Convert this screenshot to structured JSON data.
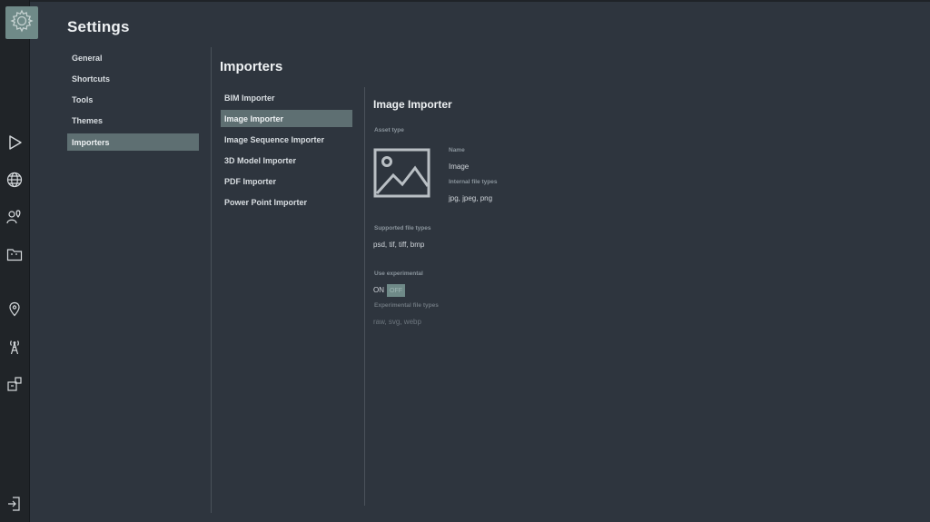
{
  "colors": {
    "background": "#2e353e",
    "rail": "#202428",
    "accent": "#6f8a88",
    "selected": "#5e6f72"
  },
  "rail": {
    "logo_icon": "gear-icon",
    "icons": [
      "play-icon",
      "globe-icon",
      "pin-person-icon",
      "folder-icon",
      "location-pin-icon",
      "antenna-icon",
      "puzzle-icon",
      "exit-icon"
    ]
  },
  "settings": {
    "title": "Settings",
    "categories": [
      "General",
      "Shortcuts",
      "Tools",
      "Themes",
      "Importers"
    ],
    "active_category": "Importers"
  },
  "importers": {
    "title": "Importers",
    "items": [
      "BIM Importer",
      "Image Importer",
      "Image Sequence Importer",
      "3D Model Importer",
      "PDF Importer",
      "Power Point Importer"
    ],
    "active_item": "Image Importer"
  },
  "detail": {
    "title": "Image Importer",
    "asset_type_label": "Asset type",
    "asset_type_icon": "image-icon",
    "name_label": "Name",
    "name_value": "Image",
    "internal_types_label": "Internal file types",
    "internal_types_value": "jpg, jpeg, png",
    "supported_label": "Supported file types",
    "supported_value": "psd, tif, tiff, bmp",
    "experimental_label": "Use experimental",
    "toggle_on": "ON",
    "toggle_off": "OFF",
    "toggle_state": "OFF",
    "experimental_types_label": "Experimental file types",
    "experimental_types_value": "raw, svg, webp"
  }
}
